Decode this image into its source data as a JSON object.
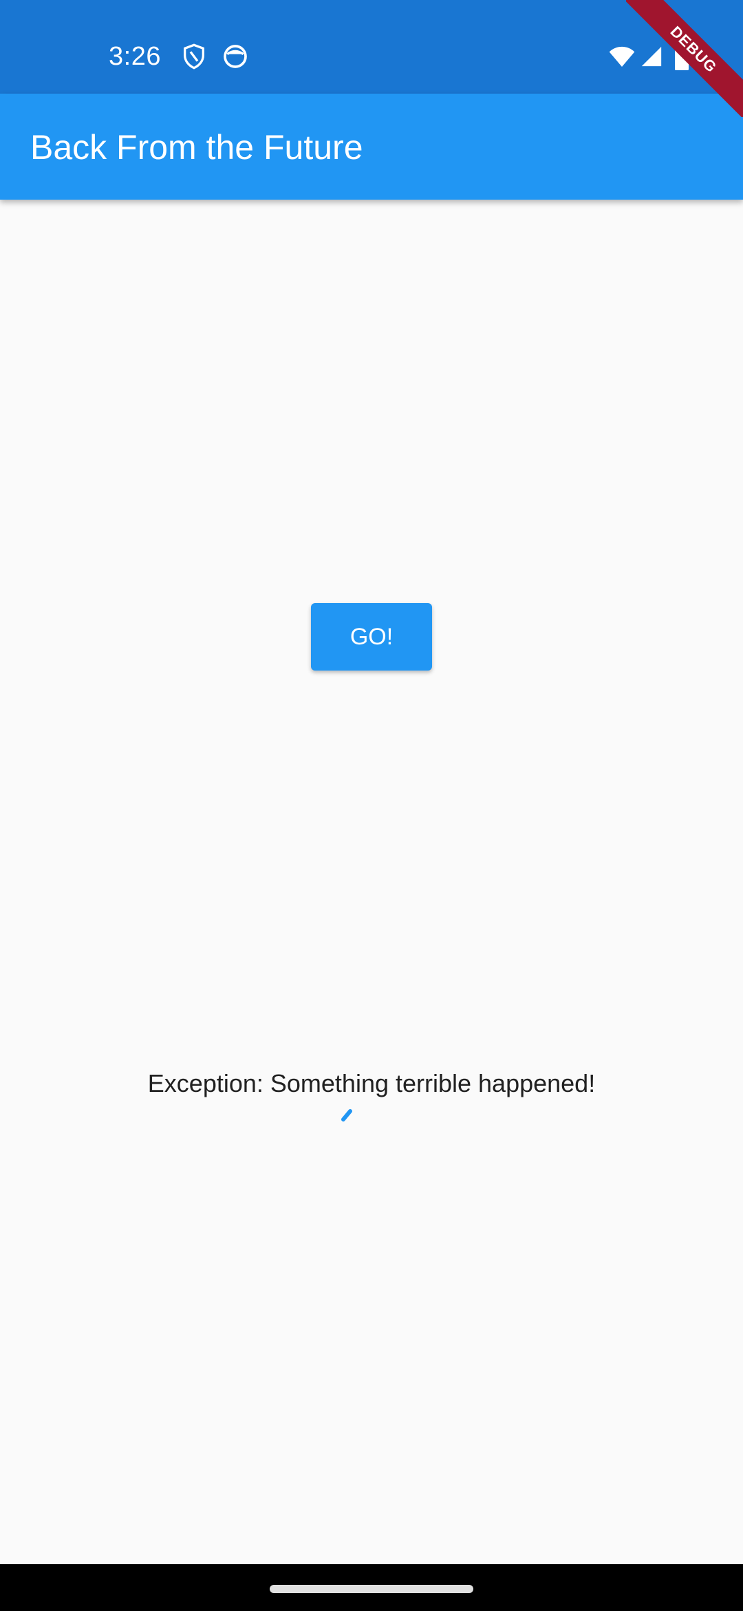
{
  "status_bar": {
    "time": "3:26",
    "icons": [
      "shield-icon",
      "face-icon",
      "wifi-icon",
      "signal-icon",
      "battery-icon"
    ],
    "color": "#1976d2"
  },
  "app_bar": {
    "title": "Back From the Future",
    "color": "#2196f3"
  },
  "debug_banner": {
    "label": "DEBUG",
    "color": "#a0152e"
  },
  "main": {
    "go_button_label": "GO!",
    "error_message": "Exception: Something terrible happened!",
    "loading_indicator": "circular-progress-icon"
  }
}
